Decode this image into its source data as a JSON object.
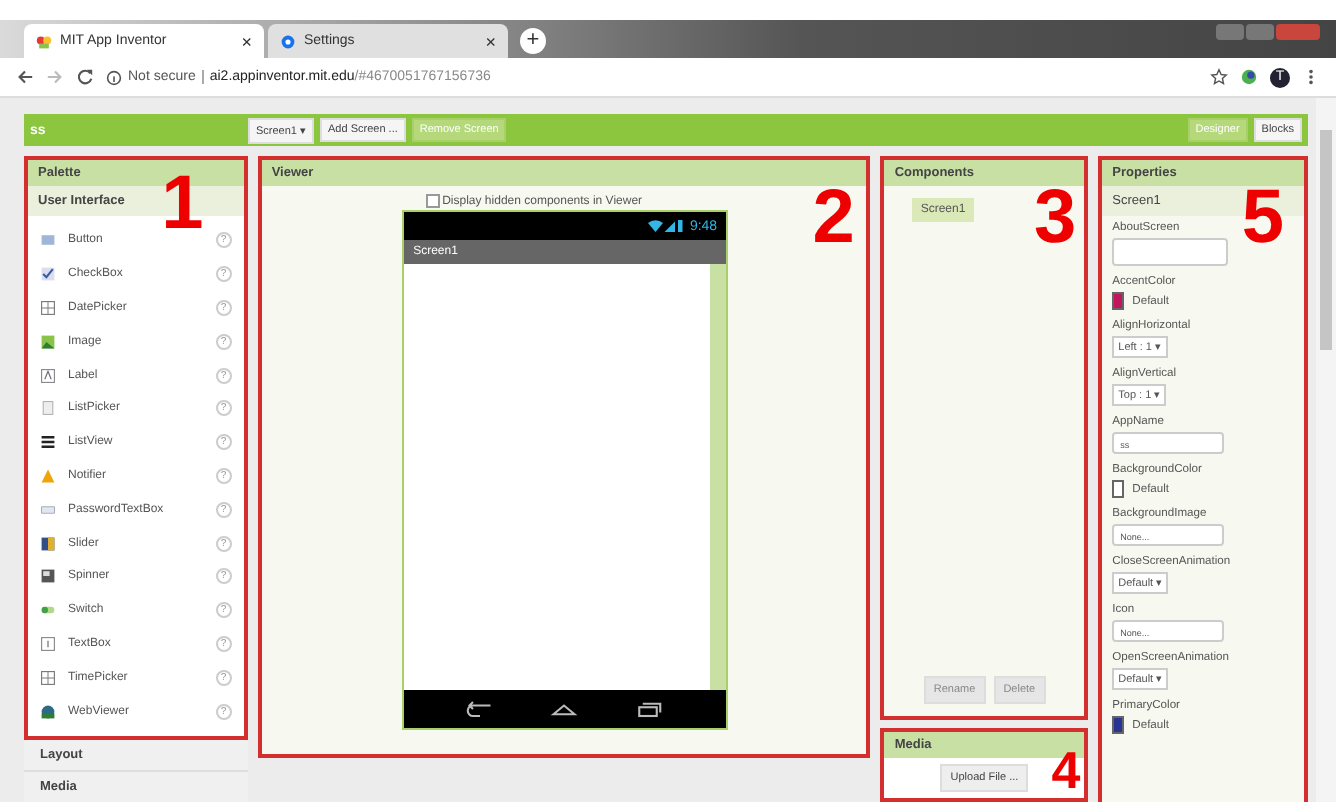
{
  "browser": {
    "tabs": [
      {
        "title": "MIT App Inventor",
        "close": "×",
        "selected": true
      },
      {
        "title": "Settings",
        "close": "×",
        "selected": false
      }
    ],
    "new_tab": "+",
    "security": "Not secure",
    "url_host": "ai2.appinventor.mit.edu",
    "url_rest": "/#4670051767156736",
    "profile": "T"
  },
  "toolbar": {
    "project": "ss",
    "screen_select": "Screen1 ▾",
    "add_screen": "Add Screen ...",
    "remove_screen": "Remove Screen",
    "designer": "Designer",
    "blocks": "Blocks"
  },
  "palette": {
    "title": "Palette",
    "section": "User Interface",
    "number": "1",
    "items": [
      {
        "label": "Button",
        "kind": "button"
      },
      {
        "label": "CheckBox",
        "kind": "checkbox"
      },
      {
        "label": "DatePicker",
        "kind": "date"
      },
      {
        "label": "Image",
        "kind": "image"
      },
      {
        "label": "Label",
        "kind": "label"
      },
      {
        "label": "ListPicker",
        "kind": "list"
      },
      {
        "label": "ListView",
        "kind": "listview"
      },
      {
        "label": "Notifier",
        "kind": "notifier"
      },
      {
        "label": "PasswordTextBox",
        "kind": "password"
      },
      {
        "label": "Slider",
        "kind": "slider"
      },
      {
        "label": "Spinner",
        "kind": "spinner"
      },
      {
        "label": "Switch",
        "kind": "switch"
      },
      {
        "label": "TextBox",
        "kind": "textbox"
      },
      {
        "label": "TimePicker",
        "kind": "time"
      },
      {
        "label": "WebViewer",
        "kind": "web"
      }
    ],
    "help": "?",
    "groups": [
      "Layout",
      "Media"
    ]
  },
  "viewer": {
    "title": "Viewer",
    "number": "2",
    "hidden_checkbox": {
      "label": "Display hidden components in Viewer",
      "checked": false
    },
    "time": "9:48",
    "screen_title": "Screen1"
  },
  "components": {
    "title": "Components",
    "number": "3",
    "tree": [
      {
        "label": "Screen1",
        "selected": true
      }
    ],
    "rename": "Rename",
    "delete": "Delete"
  },
  "media": {
    "title": "Media",
    "number": "4",
    "upload": "Upload File ..."
  },
  "properties": {
    "title": "Properties",
    "number": "5",
    "screen": "Screen1",
    "items": [
      {
        "label": "AboutScreen",
        "kind": "textarea"
      },
      {
        "label": "AccentColor",
        "kind": "color",
        "value": "Default",
        "color": "#c2185b"
      },
      {
        "label": "AlignHorizontal",
        "kind": "select",
        "value": "Left : 1 ▾"
      },
      {
        "label": "AlignVertical",
        "kind": "select",
        "value": "Top : 1 ▾"
      },
      {
        "label": "AppName",
        "kind": "text",
        "value": "ss"
      },
      {
        "label": "BackgroundColor",
        "kind": "color",
        "value": "Default",
        "color": "#ffffff"
      },
      {
        "label": "BackgroundImage",
        "kind": "text",
        "value": "None..."
      },
      {
        "label": "CloseScreenAnimation",
        "kind": "select",
        "value": "Default ▾"
      },
      {
        "label": "Icon",
        "kind": "text",
        "value": "None..."
      },
      {
        "label": "OpenScreenAnimation",
        "kind": "select",
        "value": "Default ▾"
      },
      {
        "label": "PrimaryColor",
        "kind": "color",
        "value": "Default",
        "color": "#283593"
      }
    ]
  }
}
